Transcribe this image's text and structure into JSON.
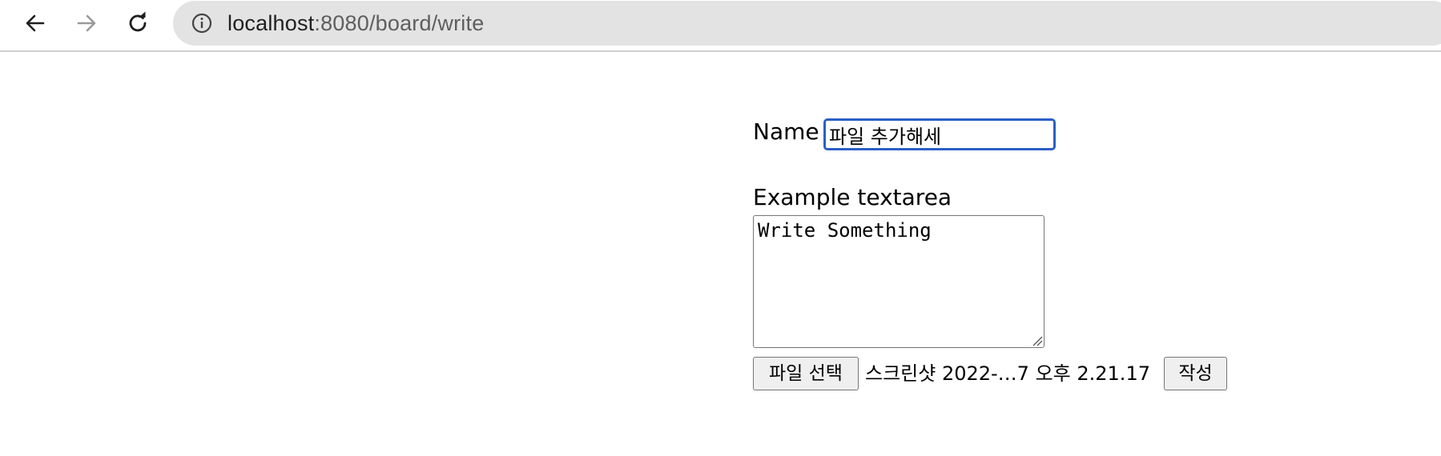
{
  "browser": {
    "icons": {
      "back": "arrow-left-icon",
      "forward": "arrow-right-icon",
      "reload": "reload-icon",
      "info": "info-icon"
    },
    "url_host": "localhost",
    "url_path": ":8080/board/write"
  },
  "form": {
    "name_label": "Name",
    "name_value": "파일 추가해세",
    "textarea_label": "Example textarea",
    "textarea_value": "Write Something",
    "file_button_label": "파일 선택",
    "file_name": "스크린샷 2022-…7 오후 2.21.17",
    "submit_label": "작성"
  },
  "colors": {
    "focus_border": "#2b5fc6",
    "omnibox_bg": "#e3e3e3"
  }
}
